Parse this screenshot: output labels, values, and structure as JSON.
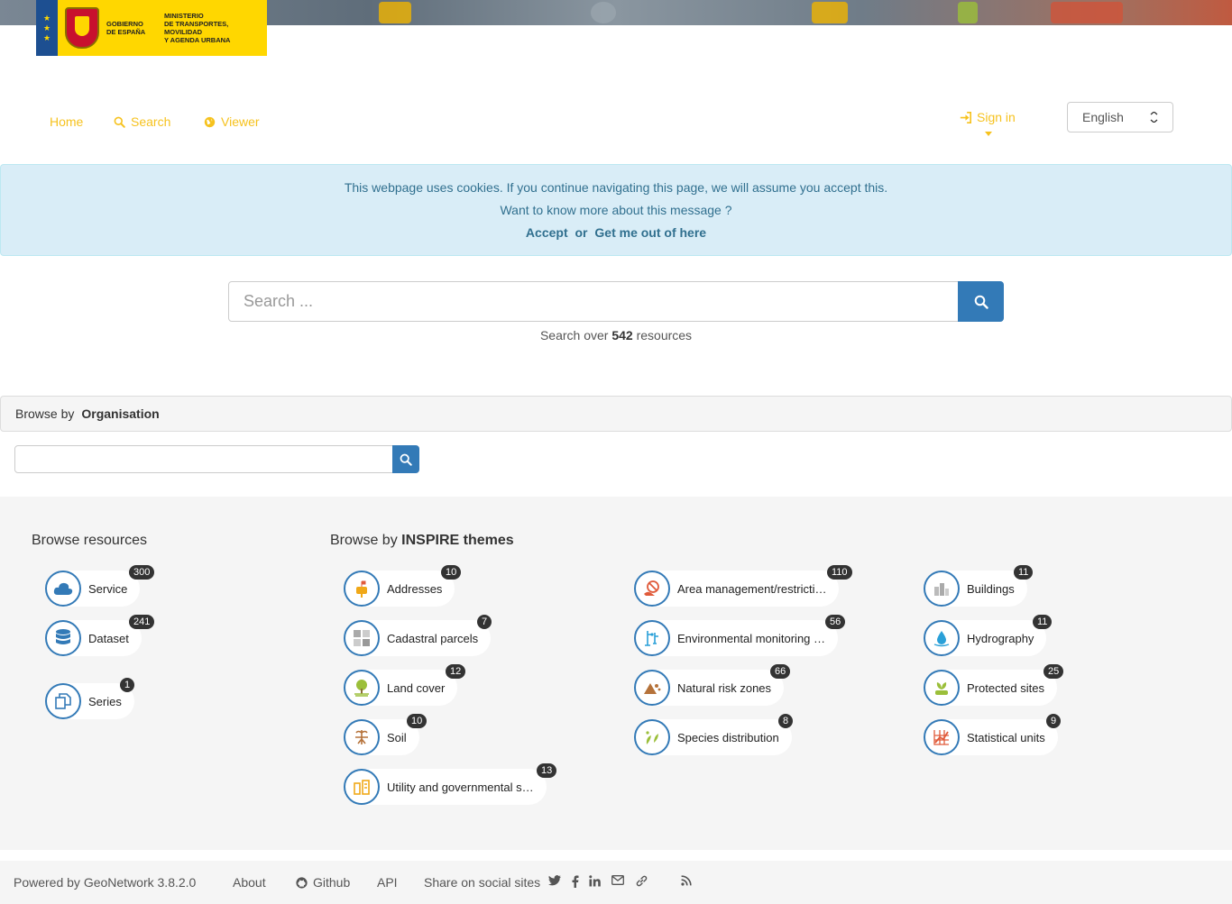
{
  "nav": {
    "home": "Home",
    "search": "Search",
    "viewer": "Viewer",
    "signin": "Sign in",
    "language": "English"
  },
  "cookie": {
    "line1": "This webpage uses cookies. If you continue navigating this page, we will assume you accept this.",
    "line2": "Want to know more about this message ?",
    "accept": "Accept",
    "or": "or",
    "leave": "Get me out of here"
  },
  "search": {
    "placeholder": "Search ...",
    "count_prefix": "Search over",
    "count": "542",
    "count_suffix": "resources"
  },
  "browse_org": {
    "prefix": "Browse by",
    "value": "Organisation"
  },
  "resources": {
    "title": "Browse resources",
    "items": [
      {
        "label": "Service",
        "count": "300",
        "icon": "cloud-icon"
      },
      {
        "label": "Dataset",
        "count": "241",
        "icon": "database-icon"
      },
      {
        "label": "Series",
        "count": "1",
        "icon": "series-icon"
      }
    ]
  },
  "themes": {
    "title_prefix": "Browse by",
    "title_bold": "INSPIRE themes",
    "items": [
      {
        "label": "Addresses",
        "count": "10",
        "icon": "mailbox-icon"
      },
      {
        "label": "Cadastral parcels",
        "count": "7",
        "icon": "parcels-icon"
      },
      {
        "label": "Land cover",
        "count": "12",
        "icon": "tree-icon"
      },
      {
        "label": "Soil",
        "count": "10",
        "icon": "plant-roots-icon"
      },
      {
        "label": "Utility and governmental s…",
        "count": "13",
        "icon": "utility-icon"
      },
      {
        "label": "Area management/restricti…",
        "count": "110",
        "icon": "restriction-icon"
      },
      {
        "label": "Environmental monitoring …",
        "count": "56",
        "icon": "monitoring-icon"
      },
      {
        "label": "Natural risk zones",
        "count": "66",
        "icon": "mountain-icon"
      },
      {
        "label": "Species distribution",
        "count": "8",
        "icon": "species-icon"
      },
      {
        "label": "Buildings",
        "count": "11",
        "icon": "buildings-icon"
      },
      {
        "label": "Hydrography",
        "count": "11",
        "icon": "water-drop-icon"
      },
      {
        "label": "Protected sites",
        "count": "25",
        "icon": "protected-icon"
      },
      {
        "label": "Statistical units",
        "count": "9",
        "icon": "chart-grid-icon"
      }
    ]
  },
  "footer": {
    "powered": "Powered by GeoNetwork 3.8.2.0",
    "about": "About",
    "github": "Github",
    "api": "API",
    "share": "Share on social sites"
  },
  "colors": {
    "accent": "#f6c21e",
    "primary": "#337ab7",
    "info_bg": "#d9edf7",
    "info_text": "#31708f"
  }
}
